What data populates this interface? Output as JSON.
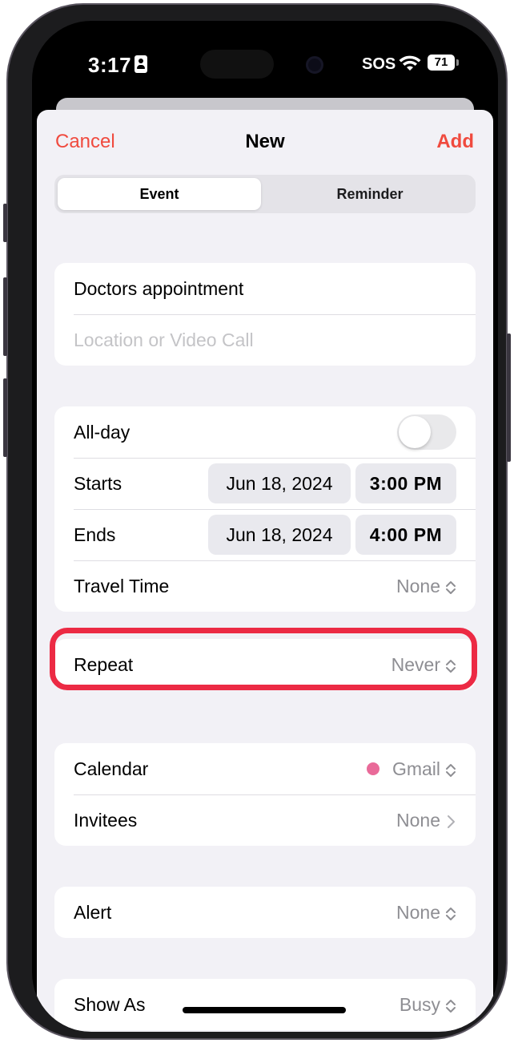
{
  "status_bar": {
    "time": "3:17",
    "sos": "SOS",
    "battery": "71"
  },
  "nav": {
    "cancel": "Cancel",
    "title": "New",
    "add": "Add"
  },
  "segments": {
    "event": "Event",
    "reminder": "Reminder"
  },
  "details": {
    "title_value": "Doctors appointment",
    "location_placeholder": "Location or Video Call"
  },
  "timing": {
    "all_day_label": "All-day",
    "all_day_on": false,
    "starts_label": "Starts",
    "starts_date": "Jun 18, 2024",
    "starts_time": "3:00 PM",
    "ends_label": "Ends",
    "ends_date": "Jun 18, 2024",
    "ends_time": "4:00 PM",
    "travel_label": "Travel Time",
    "travel_value": "None"
  },
  "repeat": {
    "label": "Repeat",
    "value": "Never"
  },
  "calendar": {
    "label": "Calendar",
    "value": "Gmail",
    "color": "#e96a99",
    "invitees_label": "Invitees",
    "invitees_value": "None"
  },
  "alert": {
    "label": "Alert",
    "value": "None"
  },
  "show_as": {
    "label": "Show As",
    "value": "Busy"
  },
  "colors": {
    "accent": "#f04a3e",
    "highlight": "#ec2a44"
  }
}
